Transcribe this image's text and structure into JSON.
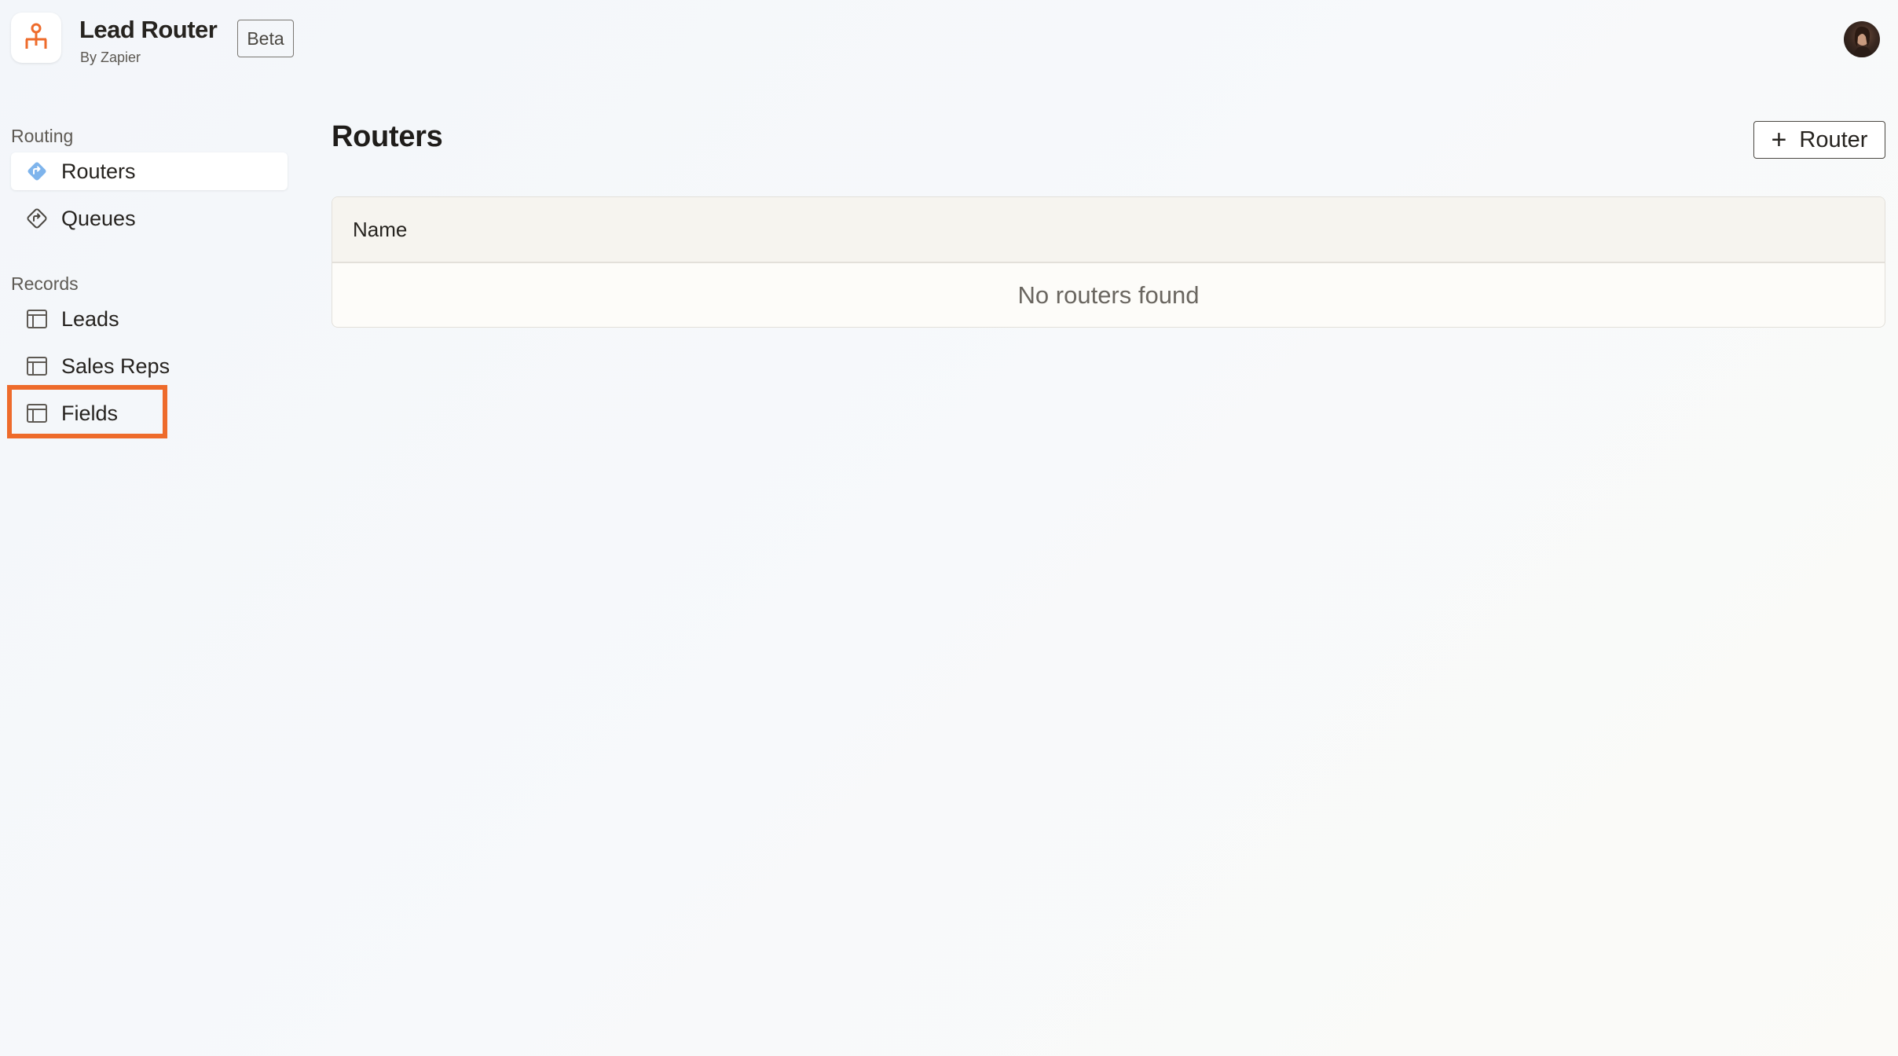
{
  "header": {
    "app_title": "Lead Router",
    "app_subtitle": "By Zapier",
    "badge": "Beta",
    "logo_icon": "org-chart-icon",
    "accent_color": "#ee6b2b"
  },
  "sidebar": {
    "sections": [
      {
        "label": "Routing",
        "items": [
          {
            "label": "Routers",
            "icon": "router-diamond-icon",
            "active": true
          },
          {
            "label": "Queues",
            "icon": "queue-diamond-icon",
            "active": false
          }
        ]
      },
      {
        "label": "Records",
        "items": [
          {
            "label": "Leads",
            "icon": "table-icon",
            "active": false
          },
          {
            "label": "Sales Reps",
            "icon": "table-icon",
            "active": false
          },
          {
            "label": "Fields",
            "icon": "table-icon",
            "active": false,
            "highlighted": true
          }
        ]
      }
    ]
  },
  "main": {
    "title": "Routers",
    "add_button_label": "Router",
    "add_button_icon": "plus-icon",
    "table": {
      "columns": [
        "Name"
      ],
      "empty_message": "No routers found"
    }
  },
  "colors": {
    "highlight": "#ee6b2b",
    "router_icon": "#4a90e2"
  }
}
